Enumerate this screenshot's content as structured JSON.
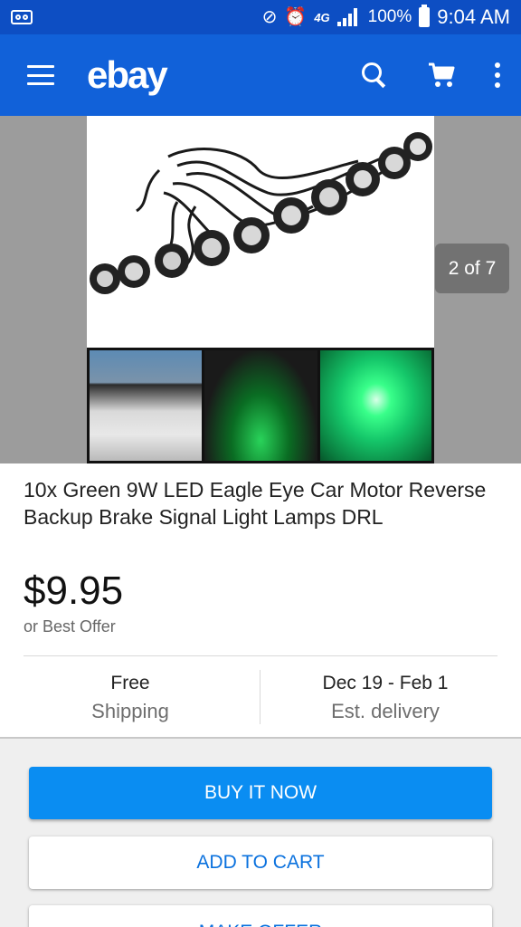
{
  "status_bar": {
    "battery": "100%",
    "time": "9:04 AM",
    "network": "4G",
    "icons": [
      "gallery-icon",
      "voicemail-icon",
      "vibrate-off-icon",
      "alarm-icon",
      "lte-icon",
      "signal-icon",
      "battery-icon"
    ]
  },
  "app_bar": {
    "logo": "ebay",
    "icons": [
      "menu-icon",
      "search-icon",
      "cart-icon",
      "more-icon"
    ],
    "color": "#1161d9"
  },
  "gallery": {
    "counter": "2 of 7"
  },
  "listing": {
    "title": "10x Green 9W LED Eagle Eye Car Motor Reverse Backup Brake Signal Light Lamps DRL",
    "price": "$9.95",
    "offer_note": "or Best Offer",
    "shipping_main": "Free",
    "shipping_sub": "Shipping",
    "delivery_main": "Dec 19 - Feb 1",
    "delivery_sub": "Est. delivery"
  },
  "actions": {
    "buy_now": "BUY IT NOW",
    "add_to_cart": "ADD TO CART",
    "make_offer": "MAKE OFFER"
  },
  "colors": {
    "status_bar": "#0d4ec3",
    "buy_button": "#0a8df2",
    "link_text": "#0a71de"
  }
}
